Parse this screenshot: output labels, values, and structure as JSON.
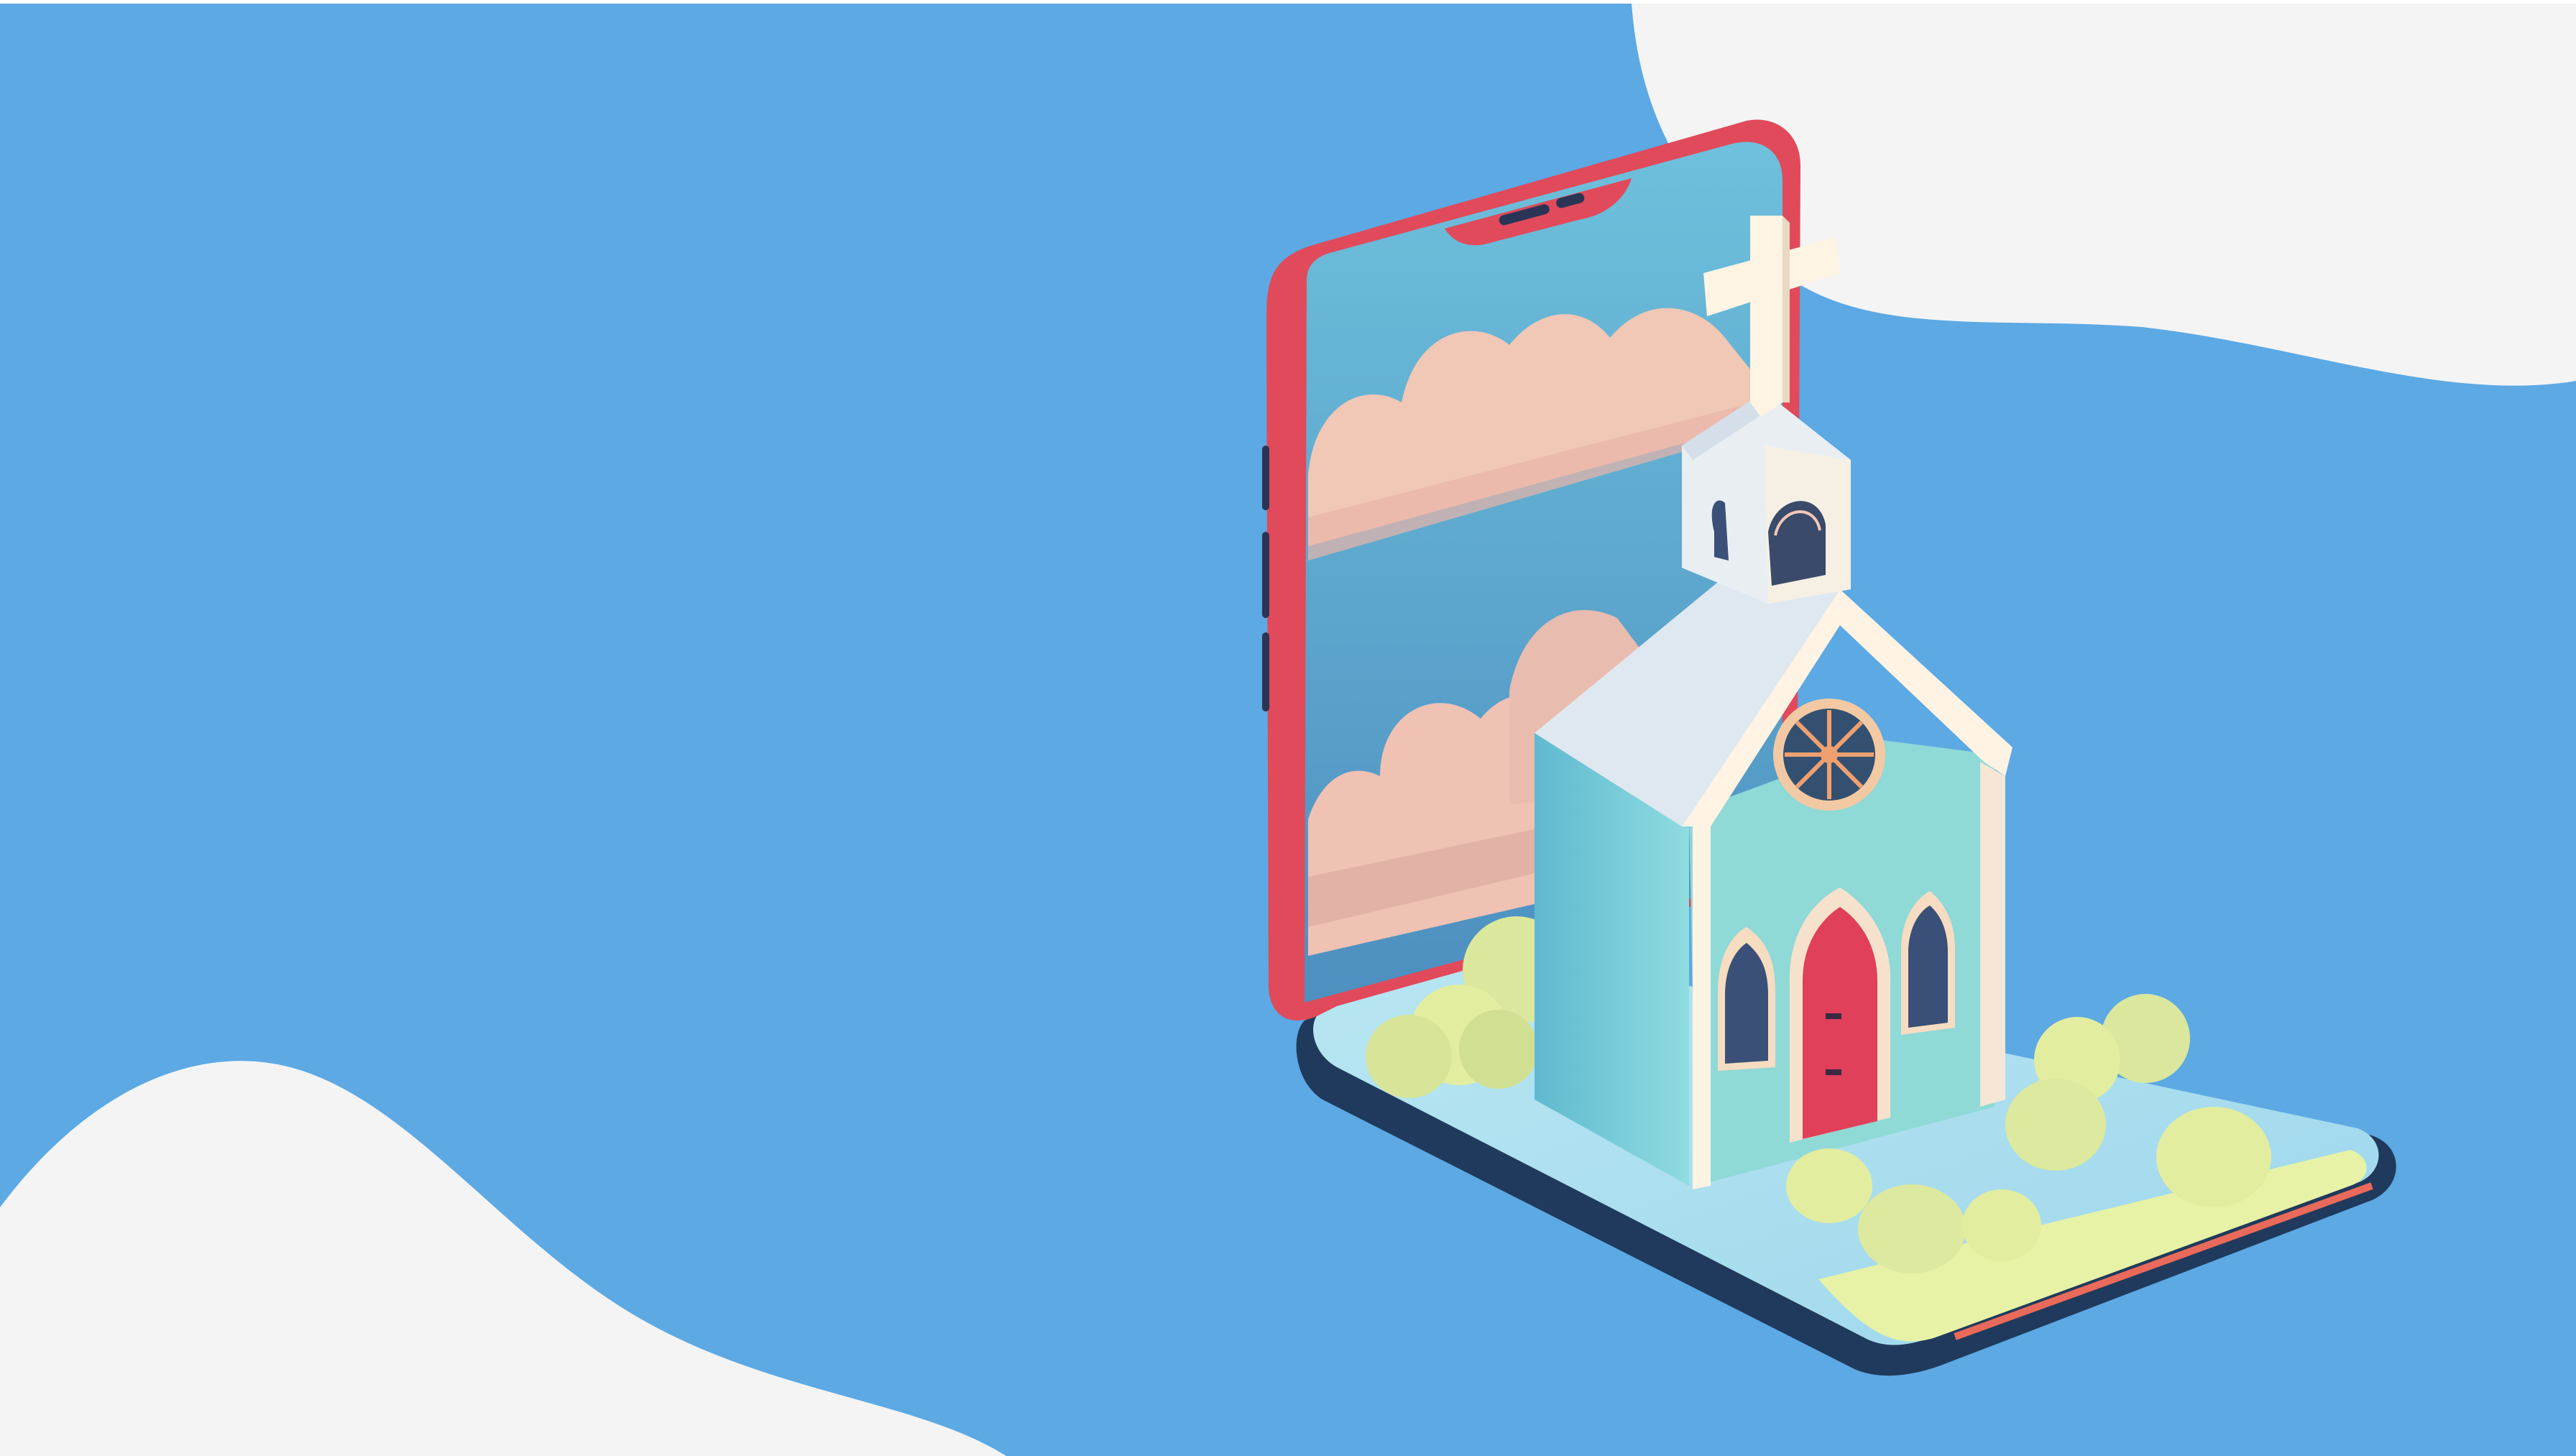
{
  "colors": {
    "background": "#5ca9e4",
    "blob": "#f4f4f4",
    "phone_frame": "#e04a5a",
    "phone_base": "#1f3a5c",
    "screen_sky": "#5fb4d6",
    "cloud": "#f2c9b8",
    "ground": "#a8def0",
    "bush": "#e3eda0",
    "church_wall": "#7fd0dc",
    "church_trim": "#fff3e4",
    "roof": "#dfe8f0",
    "door": "#e0405a"
  },
  "illustration": {
    "subject": "isometric-phone-with-church",
    "icons": [
      "cross-icon",
      "rose-window-icon",
      "door-icon",
      "bush-icon",
      "cloud-icon"
    ]
  }
}
